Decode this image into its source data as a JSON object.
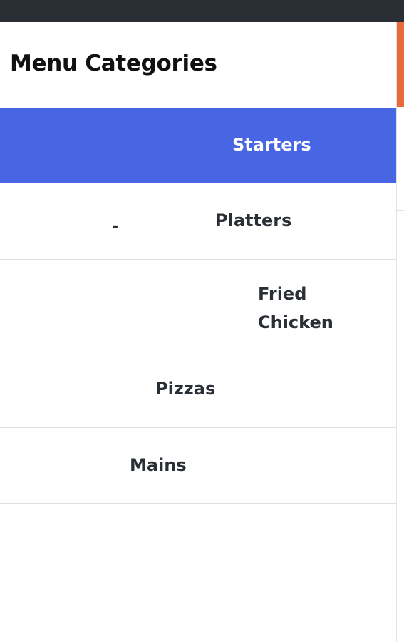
{
  "menu": {
    "title": "Menu Categories",
    "categories": [
      {
        "label": "Starters",
        "active": true
      },
      {
        "label": "Platters",
        "marker": "-",
        "active": false
      },
      {
        "label": "Fried\nChicken",
        "active": false
      },
      {
        "label": "Pizzas",
        "active": false
      },
      {
        "label": "Mains",
        "active": false
      }
    ]
  },
  "colors": {
    "active_bg": "#4866e3",
    "topbar": "#2a2f35",
    "accent": "#ea6a3c"
  }
}
